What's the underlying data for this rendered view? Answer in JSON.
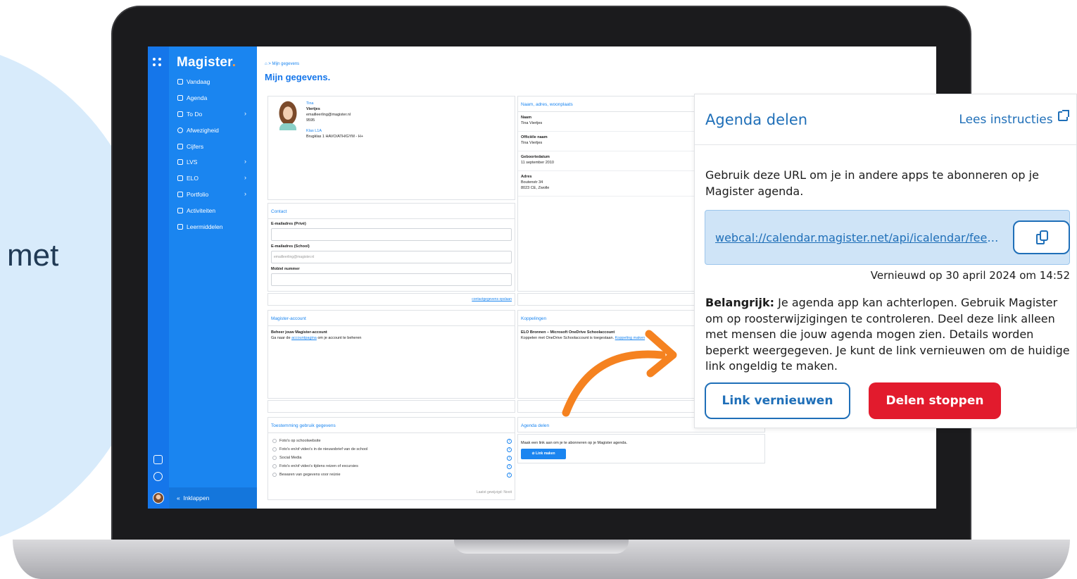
{
  "side_text": "met",
  "app": {
    "logo": "Magister",
    "logo_dot": ".",
    "accent": "#1a85f0",
    "nav": [
      {
        "label": "Vandaag",
        "icon": "home-icon",
        "chevron": false
      },
      {
        "label": "Agenda",
        "icon": "calendar-icon",
        "chevron": false
      },
      {
        "label": "To Do",
        "icon": "checkbox-icon",
        "chevron": true
      },
      {
        "label": "Afwezigheid",
        "icon": "check-circle-icon",
        "chevron": false
      },
      {
        "label": "Cijfers",
        "icon": "grades-icon",
        "chevron": false
      },
      {
        "label": "LVS",
        "icon": "lvs-icon",
        "chevron": true
      },
      {
        "label": "ELO",
        "icon": "elo-icon",
        "chevron": true
      },
      {
        "label": "Portfolio",
        "icon": "portfolio-icon",
        "chevron": true
      },
      {
        "label": "Activiteiten",
        "icon": "activities-icon",
        "chevron": false
      },
      {
        "label": "Leermiddelen",
        "icon": "books-icon",
        "chevron": false
      }
    ],
    "collapse_label": "Inklappen",
    "collapse_glyph": "«",
    "chevron_glyph": "›"
  },
  "page": {
    "breadcrumb": "> Mijn gegevens",
    "title": "Mijn gegevens."
  },
  "profile": {
    "first_name": "Tina",
    "last_name": "Viertjes",
    "email": "emailleerling@magister.nl",
    "number": "9595",
    "class_link": "Klas L1A",
    "class_desc": "Brugklas 1 HAVO/ATH/GYM - H+"
  },
  "address_card": {
    "header": "Naam, adres, woonplaats",
    "rows": [
      {
        "label": "Naam",
        "value": "Tina Viertjes"
      },
      {
        "label": "Officiële naam",
        "value": "Tina Viertjes"
      },
      {
        "label": "Geboortedatum",
        "value": "11 september 2010"
      },
      {
        "label": "Adres",
        "value": "Boutenstr 34",
        "value2": "8023 CE, Zwolle"
      }
    ]
  },
  "contact": {
    "header": "Contact",
    "email_private_label": "E-mailadres (Privé)",
    "email_school_label": "E-mailadres (School)",
    "email_school_value": "emailleerling@magister.nl",
    "mobile_label": "Mobiel nummer",
    "save_link": "contactgegevens opslaan"
  },
  "magister_account": {
    "header": "Magister-account",
    "title": "Beheer jouw Magister-account",
    "text_pre": "Ga naar de",
    "link": "accountpagina",
    "text_post": "om je account te beheren"
  },
  "koppelingen": {
    "header": "Koppelingen",
    "title": "ELO Bronnen – Microsoft OneDrive Schoolaccount",
    "text": "Koppelen met OneDrive Schoolaccount is toegestaan.",
    "link": "Koppeling maken"
  },
  "consent": {
    "header": "Toestemming gebruik gegevens",
    "items": [
      "Foto's op schoolwebsite",
      "Foto's en/of video's in de nieuwsbrief van de school",
      "Social Media",
      "Foto's en/of video's tijdens reizen of excursies",
      "Bewaren van gegevens voor reünie"
    ],
    "info_glyph": "i",
    "last_changed": "Laatst gewijzigd: Nooit"
  },
  "agenda_card": {
    "header": "Agenda delen",
    "text": "Maak een link aan om je te abonneren op je Magister agenda.",
    "button": "Link maken"
  },
  "panel": {
    "title": "Agenda delen",
    "instructions": "Lees instructies",
    "description": "Gebruik deze URL om je in andere apps te abonneren op je Magister agenda.",
    "url": "webcal://calendar.magister.net/api/icalendar/feed...",
    "renewed": "Vernieuwd op 30 april 2024 om 14:52",
    "important_label": "Belangrijk:",
    "important_text": " Je agenda app kan achterlopen. Gebruik Magister om op roosterwijzigingen te controleren. Deel deze link alleen met mensen die jouw agenda mogen zien. Details worden beperkt weergegeven. Je kunt de link vernieuwen om de huidige link ongeldig te maken.",
    "renew_button": "Link vernieuwen",
    "stop_button": "Delen stoppen",
    "accent": "#1f6fb8",
    "danger": "#e21b2d"
  },
  "arrow_color": "#f58220"
}
